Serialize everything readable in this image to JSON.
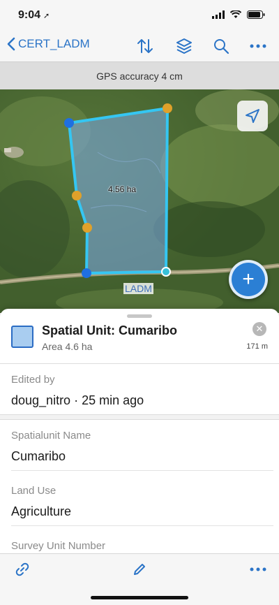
{
  "status_bar": {
    "time": "9:04",
    "location_arrow": "location-arrow-icon",
    "icons": [
      "cellular-signal-icon",
      "wifi-icon",
      "battery-icon"
    ]
  },
  "nav": {
    "back_label": "CERT_LADM",
    "icons": [
      "sort-icon",
      "layers-icon",
      "search-icon",
      "more-icon"
    ]
  },
  "gps": {
    "text": "GPS accuracy 4 cm"
  },
  "map": {
    "area_label": "4.56 ha",
    "feature_label": "LADM",
    "add_button_label": "+",
    "locate_icon": "navigation-arrow-icon",
    "colors": {
      "polygon_stroke": "#35c6f2",
      "polygon_fill": "#7aa7de",
      "vertex_blue": "#1f6fe0",
      "vertex_orange": "#e0a12a"
    }
  },
  "sheet": {
    "title": "Spatial Unit: Cumaribo",
    "subtitle": "Area 4.6 ha",
    "distance": "171 m",
    "close_label": "✕",
    "edited_by_label": "Edited by",
    "edited_by_value": "doug_nitro · 25 min ago",
    "fields": [
      {
        "label": "Spatialunit Name",
        "value": "Cumaribo"
      },
      {
        "label": "Land Use",
        "value": "Agriculture"
      },
      {
        "label": "Survey Unit Number",
        "value": ""
      }
    ]
  },
  "toolbar": {
    "icons": [
      "link-icon",
      "edit-pencil-icon",
      "more-icon"
    ]
  },
  "accent_color": "#2b74c7"
}
